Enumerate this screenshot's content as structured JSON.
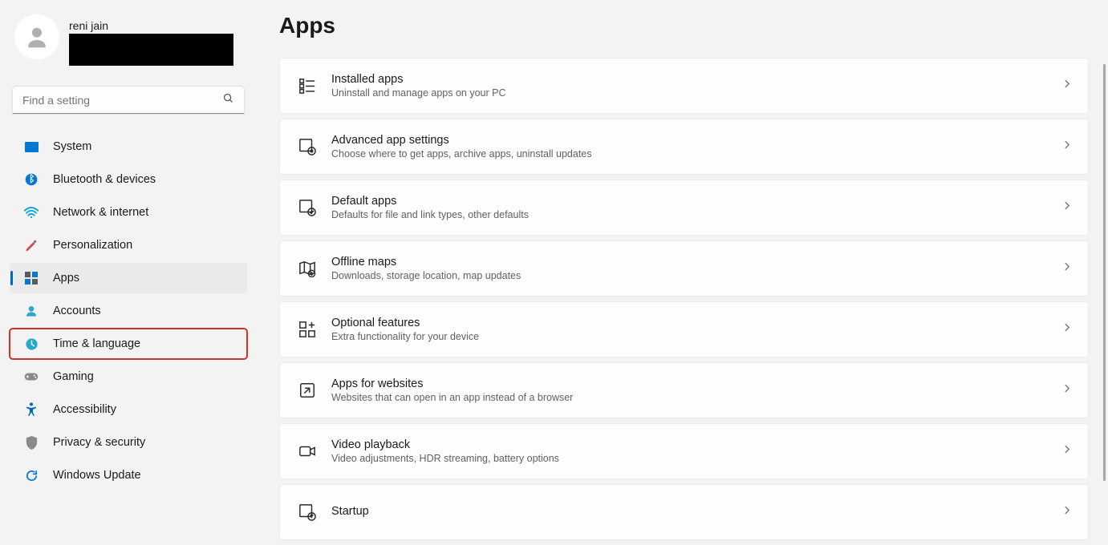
{
  "profile": {
    "name": "reni jain"
  },
  "search": {
    "placeholder": "Find a setting"
  },
  "sidebar": {
    "items": [
      {
        "id": "system",
        "label": "System"
      },
      {
        "id": "bluetooth",
        "label": "Bluetooth & devices"
      },
      {
        "id": "network",
        "label": "Network & internet"
      },
      {
        "id": "personalization",
        "label": "Personalization"
      },
      {
        "id": "apps",
        "label": "Apps",
        "selected": true
      },
      {
        "id": "accounts",
        "label": "Accounts"
      },
      {
        "id": "time-language",
        "label": "Time & language",
        "highlighted": true
      },
      {
        "id": "gaming",
        "label": "Gaming"
      },
      {
        "id": "accessibility",
        "label": "Accessibility"
      },
      {
        "id": "privacy",
        "label": "Privacy & security"
      },
      {
        "id": "windows-update",
        "label": "Windows Update"
      }
    ]
  },
  "main": {
    "title": "Apps",
    "cards": [
      {
        "id": "installed-apps",
        "title": "Installed apps",
        "desc": "Uninstall and manage apps on your PC"
      },
      {
        "id": "advanced-app-settings",
        "title": "Advanced app settings",
        "desc": "Choose where to get apps, archive apps, uninstall updates"
      },
      {
        "id": "default-apps",
        "title": "Default apps",
        "desc": "Defaults for file and link types, other defaults"
      },
      {
        "id": "offline-maps",
        "title": "Offline maps",
        "desc": "Downloads, storage location, map updates"
      },
      {
        "id": "optional-features",
        "title": "Optional features",
        "desc": "Extra functionality for your device"
      },
      {
        "id": "apps-for-websites",
        "title": "Apps for websites",
        "desc": "Websites that can open in an app instead of a browser"
      },
      {
        "id": "video-playback",
        "title": "Video playback",
        "desc": "Video adjustments, HDR streaming, battery options"
      },
      {
        "id": "startup",
        "title": "Startup",
        "desc": ""
      }
    ]
  }
}
